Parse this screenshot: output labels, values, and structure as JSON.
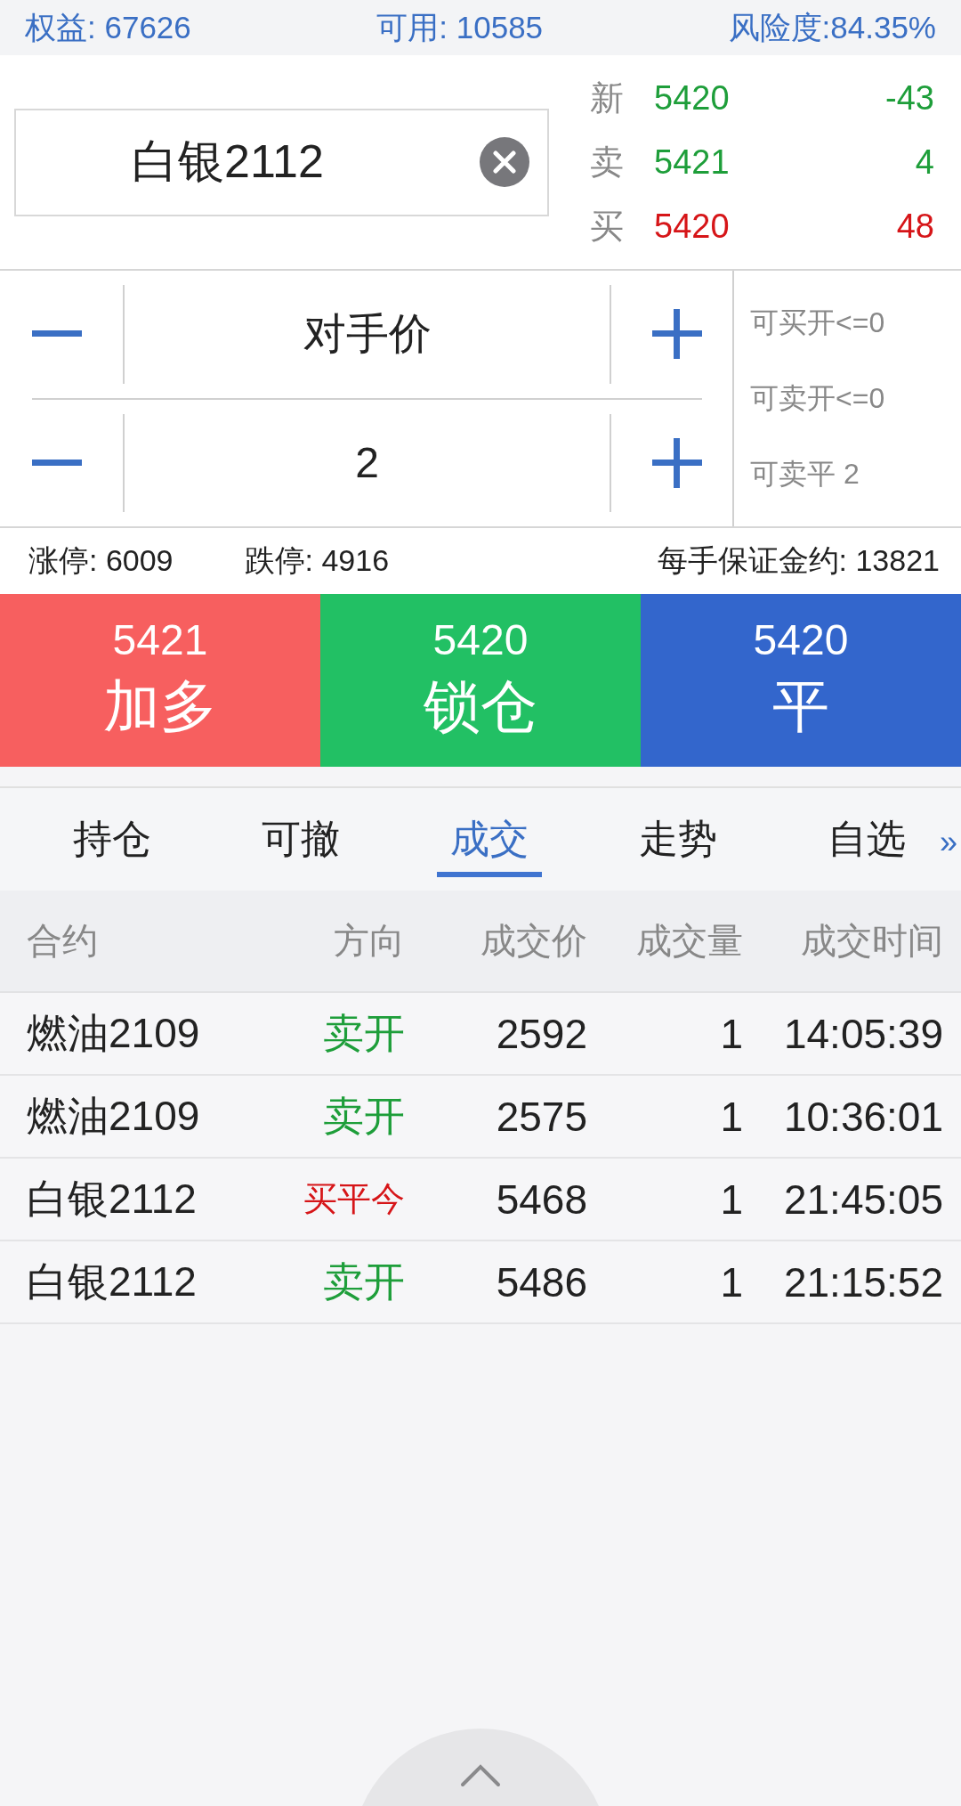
{
  "account_bar": [
    "权益: 67626",
    "可用: 10585",
    "风险度:84.35%"
  ],
  "contract_field": {
    "value": "白银2112"
  },
  "quotes": [
    {
      "label": "新",
      "price": "5420",
      "change": "-43",
      "color": "#1e9e3a"
    },
    {
      "label": "卖",
      "price": "5421",
      "change": "4",
      "color": "#1e9e3a"
    },
    {
      "label": "买",
      "price": "5420",
      "change": "48",
      "color": "#d61518"
    }
  ],
  "steppers": [
    {
      "value": "对手价"
    },
    {
      "value": "2"
    }
  ],
  "availability": [
    "可买开<=0",
    "可卖开<=0",
    "可卖平 2"
  ],
  "limits": {
    "up": "涨停: 6009",
    "down": "跌停: 4916",
    "margin": "每手保证金约: 13821"
  },
  "actions": [
    {
      "price": "5421",
      "label": "加多",
      "color": "#f75f5f"
    },
    {
      "price": "5420",
      "label": "锁仓",
      "color": "#22c064"
    },
    {
      "price": "5420",
      "label": "平",
      "color": "#3366cc"
    }
  ],
  "tabs": [
    {
      "label": "持仓",
      "selected": false
    },
    {
      "label": "可撤",
      "selected": false
    },
    {
      "label": "成交",
      "selected": true
    },
    {
      "label": "走势",
      "selected": false
    },
    {
      "label": "自选",
      "selected": false
    }
  ],
  "more_tabs": "»",
  "table": {
    "columns": [
      "合约",
      "方向",
      "成交价",
      "成交量",
      "成交时间"
    ],
    "rows": [
      {
        "contract": "燃油2109",
        "direction": "卖开",
        "kind": "sell",
        "price": "2592",
        "volume": "1",
        "time": "14:05:39"
      },
      {
        "contract": "燃油2109",
        "direction": "卖开",
        "kind": "sell",
        "price": "2575",
        "volume": "1",
        "time": "10:36:01"
      },
      {
        "contract": "白银2112",
        "direction": "买平今",
        "kind": "buy",
        "price": "5468",
        "volume": "1",
        "time": "21:45:05"
      },
      {
        "contract": "白银2112",
        "direction": "卖开",
        "kind": "sell",
        "price": "5486",
        "volume": "1",
        "time": "21:15:52"
      }
    ]
  }
}
